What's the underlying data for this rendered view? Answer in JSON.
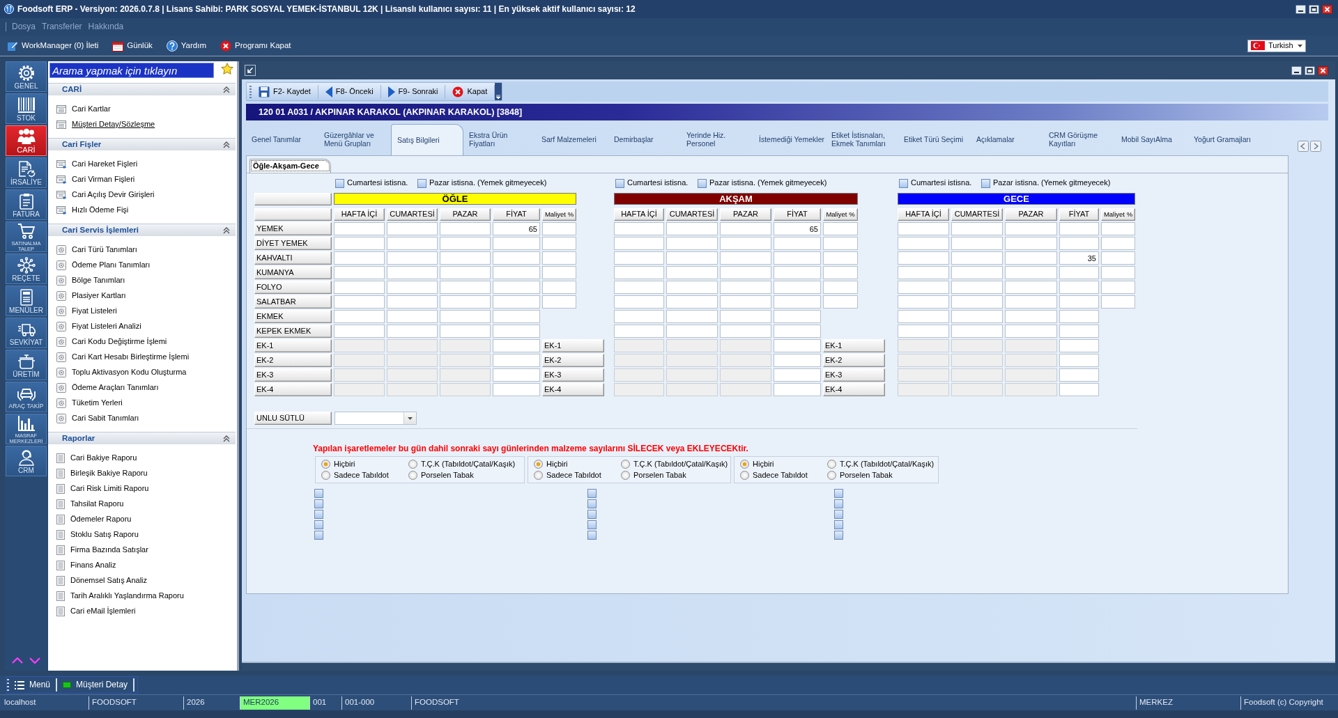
{
  "window": {
    "title": "Foodsoft ERP - Versiyon: 2026.0.7.8 | Lisans Sahibi: PARK SOSYAL YEMEK-İSTANBUL 12K | Lisanslı kullanıcı sayısı: 11 | En yüksek aktif kullanıcı sayısı: 12"
  },
  "menu": [
    {
      "label": "Dosya"
    },
    {
      "label": "Transferler"
    },
    {
      "label": "Hakkında"
    }
  ],
  "toolbar": [
    {
      "label": "WorkManager (0) İleti",
      "kind": "note"
    },
    {
      "label": "Günlük",
      "kind": "calendar"
    },
    {
      "label": "Yardım",
      "kind": "help"
    },
    {
      "label": "Programı Kapat",
      "kind": "exit"
    }
  ],
  "language": {
    "value": "Turkish"
  },
  "modules": [
    {
      "label": "GENEL",
      "kind": "gear",
      "selected": false
    },
    {
      "label": "STOK",
      "kind": "barcode",
      "selected": false
    },
    {
      "label": "CARİ",
      "kind": "people",
      "selected": true
    },
    {
      "label": "İRSALİYE",
      "kind": "waybill",
      "selected": false
    },
    {
      "label": "FATURA",
      "kind": "invoice",
      "selected": false
    },
    {
      "label": "SATINALMA TALEP",
      "kind": "cart",
      "selected": false
    },
    {
      "label": "REÇETE",
      "kind": "recipe",
      "selected": false
    },
    {
      "label": "MENÜLER",
      "kind": "menu",
      "selected": false
    },
    {
      "label": "SEVKİYAT",
      "kind": "truck",
      "selected": false
    },
    {
      "label": "ÜRETİM",
      "kind": "pot",
      "selected": false
    },
    {
      "label": "ARAÇ TAKİP",
      "kind": "car",
      "selected": false
    },
    {
      "label": "MASRAF MERKEZLERİ",
      "kind": "chart",
      "selected": false
    },
    {
      "label": "CRM",
      "kind": "crm",
      "selected": false
    }
  ],
  "search": {
    "placeholder": "Arama yapmak için tıklayın"
  },
  "nav_sections": [
    {
      "title": "CARİ",
      "kind": "cards",
      "expanded": true,
      "items": [
        {
          "label": "Cari Kartlar",
          "selected": false
        },
        {
          "label": "Müşteri Detay/Sözleşme",
          "selected": true
        }
      ]
    },
    {
      "title": "Cari Fişler",
      "kind": "slips",
      "expanded": true,
      "items": [
        {
          "label": "Cari Hareket Fişleri",
          "selected": false
        },
        {
          "label": "Cari Virman Fişleri",
          "selected": false
        },
        {
          "label": "Cari Açılış Devir Girişleri",
          "selected": false
        },
        {
          "label": "Hızlı Ödeme Fişi",
          "selected": false
        }
      ]
    },
    {
      "title": "Cari Servis İşlemleri",
      "kind": "settings",
      "expanded": true,
      "items": [
        {
          "label": "Cari Türü Tanımları",
          "selected": false
        },
        {
          "label": "Ödeme Planı Tanımları",
          "selected": false
        },
        {
          "label": "Bölge Tanımları",
          "selected": false
        },
        {
          "label": "Plasiyer Kartları",
          "selected": false
        },
        {
          "label": "Fiyat Listeleri",
          "selected": false
        },
        {
          "label": "Fiyat Listeleri Analizi",
          "selected": false
        },
        {
          "label": "Cari Kodu Değiştirme İşlemi",
          "selected": false
        },
        {
          "label": "Cari Kart Hesabı Birleştirme İşlemi",
          "selected": false
        },
        {
          "label": "Toplu Aktivasyon Kodu Oluşturma",
          "selected": false
        },
        {
          "label": "Ödeme Araçları Tanımları",
          "selected": false
        },
        {
          "label": "Tüketim Yerleri",
          "selected": false
        },
        {
          "label": "Cari Sabit Tanımları",
          "selected": false
        }
      ]
    },
    {
      "title": "Raporlar",
      "kind": "reports",
      "expanded": true,
      "items": [
        {
          "label": "Cari Bakiye Raporu",
          "selected": false
        },
        {
          "label": "Birleşik Bakiye Raporu",
          "selected": false
        },
        {
          "label": "Cari Risk Limiti Raporu",
          "selected": false
        },
        {
          "label": "Tahsilat Raporu",
          "selected": false
        },
        {
          "label": "Ödemeler Raporu",
          "selected": false
        },
        {
          "label": "Stoklu Satış Raporu",
          "selected": false
        },
        {
          "label": "Firma Bazında Satışlar",
          "selected": false
        },
        {
          "label": "Finans Analiz",
          "selected": false
        },
        {
          "label": "Dönemsel Satış Analiz",
          "selected": false
        },
        {
          "label": "Tarih Aralıklı Yaşlandırma Raporu",
          "selected": false
        },
        {
          "label": "Cari eMail İşlemleri",
          "selected": false
        }
      ]
    }
  ],
  "document": {
    "toolbar": [
      {
        "label": "F2- Kaydet",
        "kind": "save"
      },
      {
        "label": "F8- Önceki",
        "kind": "previous"
      },
      {
        "label": "F9- Sonraki",
        "kind": "next"
      },
      {
        "label": "Kapat",
        "kind": "close"
      }
    ],
    "header": "120 01 A031 / AKPINAR KARAKOL (AKPINAR KARAKOL) [3848]",
    "tabs": [
      {
        "label": "Genel Tanımlar",
        "selected": false
      },
      {
        "label": "Güzergâhlar ve Menü Grupları",
        "selected": false
      },
      {
        "label": "Satış Bilgileri",
        "selected": true
      },
      {
        "label": "Ekstra Ürün Fiyatları",
        "selected": false
      },
      {
        "label": "Sarf Malzemeleri",
        "selected": false
      },
      {
        "label": "Demirbaşlar",
        "selected": false
      },
      {
        "label": "Yerinde Hiz. Personel",
        "selected": false
      },
      {
        "label": "İstemediği Yemekler",
        "selected": false
      },
      {
        "label": "Etiket İstisnaları, Ekmek Tanımları",
        "selected": false
      },
      {
        "label": "Etiket Türü Seçimi",
        "selected": false
      },
      {
        "label": "Açıklamalar",
        "selected": false
      },
      {
        "label": "CRM Görüşme Kayıtları",
        "selected": false
      },
      {
        "label": "Mobil SayıAlma",
        "selected": false
      },
      {
        "label": "Yoğurt Gramajları",
        "selected": false
      }
    ],
    "subtabs": [
      {
        "label": "Öğle-Akşam-Gece",
        "selected": true
      }
    ],
    "rows": [
      {
        "label": "YEMEK",
        "kind": "costed"
      },
      {
        "label": "DİYET YEMEK",
        "kind": "costed"
      },
      {
        "label": "KAHVALTI",
        "kind": "costed"
      },
      {
        "label": "KUMANYA",
        "kind": "costed"
      },
      {
        "label": "FOLYO",
        "kind": "costed"
      },
      {
        "label": "SALATBAR",
        "kind": "costed"
      },
      {
        "label": "EKMEK",
        "kind": "plain"
      },
      {
        "label": "KEPEK EKMEK",
        "kind": "plain"
      },
      {
        "label": "EK-1",
        "kind": "extra"
      },
      {
        "label": "EK-2",
        "kind": "extra"
      },
      {
        "label": "EK-3",
        "kind": "extra"
      },
      {
        "label": "EK-4",
        "kind": "extra"
      }
    ],
    "meals": [
      {
        "title": "ÖĞLE",
        "color": "#ffff00",
        "options": [
          {
            "label": "Cumartesi istisna.",
            "checked": false
          },
          {
            "label": "Pazar istisna. (Yemek gitmeyecek)",
            "checked": false
          }
        ],
        "columns": [
          "HAFTA İÇİ",
          "CUMARTESİ",
          "PAZAR",
          "FİYAT",
          "Maliyet %"
        ],
        "rows": [
          {
            "fiyat": "65"
          },
          {},
          {},
          {},
          {},
          {},
          {},
          {},
          {},
          {},
          {},
          {}
        ],
        "extra_buttons": [
          "EK-1",
          "EK-2",
          "EK-3",
          "EK-4"
        ]
      },
      {
        "title": "AKŞAM",
        "color": "#800000",
        "options": [
          {
            "label": "Cumartesi istisna.",
            "checked": false
          },
          {
            "label": "Pazar istisna. (Yemek gitmeyecek)",
            "checked": false
          }
        ],
        "columns": [
          "HAFTA İÇİ",
          "CUMARTESİ",
          "PAZAR",
          "FİYAT",
          "Maliyet %"
        ],
        "rows": [
          {
            "fiyat": "65"
          },
          {},
          {},
          {},
          {},
          {},
          {},
          {},
          {},
          {},
          {},
          {}
        ],
        "extra_buttons": [
          "EK-1",
          "EK-2",
          "EK-3",
          "EK-4"
        ]
      },
      {
        "title": "GECE",
        "color": "#0000ff",
        "options": [
          {
            "label": "Cumartesi istisna.",
            "checked": false
          },
          {
            "label": "Pazar istisna. (Yemek gitmeyecek)",
            "checked": false
          }
        ],
        "columns": [
          "HAFTA İÇİ",
          "CUMARTESİ",
          "PAZAR",
          "FİYAT",
          "Maliyet %"
        ],
        "rows": [
          {},
          {},
          {
            "fiyat": "35"
          },
          {},
          {},
          {},
          {},
          {},
          {},
          {},
          {},
          {}
        ]
      }
    ],
    "unlu_sutlu": {
      "label": "UNLU SÜTLÜ"
    },
    "warning": "Yapılan işaretlemeler bu gün dahil sonraki sayı günlerinden malzeme sayılarını SİLECEK veya EKLEYECEKtir.",
    "serving_groups": [
      {
        "options": [
          {
            "label": "Hiçbiri",
            "selected": true
          },
          {
            "label": "T.Ç.K (Tabıldot/Çatal/Kaşık)",
            "selected": false
          },
          {
            "label": "Sadece Tabıldot",
            "selected": false
          },
          {
            "label": "Porselen Tabak",
            "selected": false
          }
        ],
        "flags": [
          {
            "checked": false
          },
          {
            "checked": false
          },
          {
            "checked": false
          },
          {
            "checked": false
          },
          {
            "checked": false
          }
        ]
      },
      {
        "options": [
          {
            "label": "Hiçbiri",
            "selected": true
          },
          {
            "label": "T.Ç.K (Tabıldot/Çatal/Kaşık)",
            "selected": false
          },
          {
            "label": "Sadece Tabıldot",
            "selected": false
          },
          {
            "label": "Porselen Tabak",
            "selected": false
          }
        ],
        "flags": [
          {
            "checked": false
          },
          {
            "checked": false
          },
          {
            "checked": false
          },
          {
            "checked": false
          },
          {
            "checked": false
          }
        ]
      },
      {
        "options": [
          {
            "label": "Hiçbiri",
            "selected": true
          },
          {
            "label": "T.Ç.K (Tabıldot/Çatal/Kaşık)",
            "selected": false
          },
          {
            "label": "Sadece Tabıldot",
            "selected": false
          },
          {
            "label": "Porselen Tabak",
            "selected": false
          }
        ],
        "flags": [
          {
            "checked": false
          },
          {
            "checked": false
          },
          {
            "checked": false
          },
          {
            "checked": false
          },
          {
            "checked": false
          }
        ]
      }
    ]
  },
  "taskbar": [
    {
      "label": "Menü",
      "kind": "menu"
    },
    {
      "label": "Müşteri Detay",
      "kind": "form"
    }
  ],
  "status_bar": [
    {
      "text": "localhost",
      "highlighted": false
    },
    {
      "text": "FOODSOFT",
      "highlighted": false
    },
    {
      "text": "2026",
      "highlighted": false
    },
    {
      "text": "MER2026",
      "highlighted": true
    },
    {
      "text": "001",
      "highlighted": false
    },
    {
      "text": "001-000",
      "highlighted": false
    },
    {
      "text": "FOODSOFT",
      "highlighted": false
    },
    {
      "text": "MERKEZ",
      "highlighted": false
    },
    {
      "text": "Foodsoft (c) Copyright",
      "highlighted": false
    }
  ]
}
